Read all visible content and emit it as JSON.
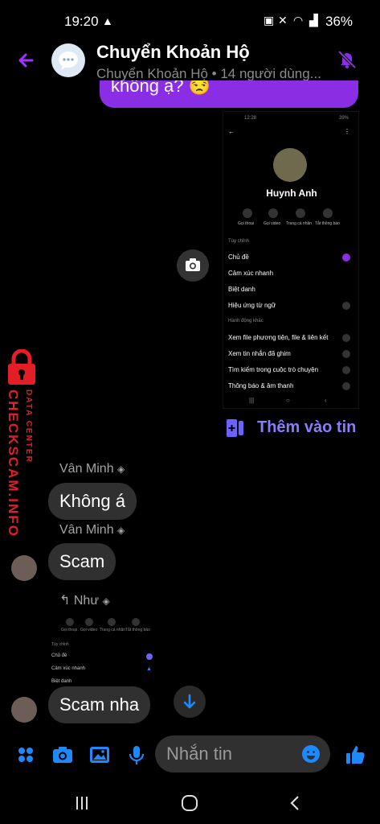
{
  "status_bar": {
    "time": "19:20",
    "battery": "36%"
  },
  "header": {
    "title": "Chuyển Khoản Hộ",
    "subtitle": "Chuyển Khoản Hộ • 14 người dùng..."
  },
  "previous_message": {
    "text": "không ạ? 😒"
  },
  "shared_screenshot": {
    "time": "12:28",
    "battery": "39%",
    "profile_name": "Huynh Anh",
    "actions": [
      "Gọi thoại",
      "Gọi video",
      "Trang cá nhân",
      "Tắt thông báo"
    ],
    "section_customize": "Tùy chỉnh",
    "customize_items": [
      "Chủ đề",
      "Cảm xúc nhanh",
      "Biệt danh",
      "Hiệu ứng từ ngữ"
    ],
    "section_other": "Hành động khác",
    "other_items": [
      "Xem file phương tiện, file & liên kết",
      "Xem tin nhắn đã ghim",
      "Tìm kiếm trong cuộc trò chuyện",
      "Thông báo & âm thanh"
    ]
  },
  "add_story": {
    "label": "Thêm vào tin"
  },
  "watermark": {
    "title": "CHECKSCAM.INFO",
    "subtitle": "DATA CENTER"
  },
  "messages": [
    {
      "sender": "Vân Minh",
      "text": "Không á"
    },
    {
      "sender": "Vân Minh",
      "text": "Scam"
    }
  ],
  "reply": {
    "label": "Như"
  },
  "shared_screenshot_2": {
    "actions": [
      "Gọi thoại",
      "Gọi video",
      "Trang cá nhân",
      "Tắt thông báo"
    ],
    "section_customize": "Tùy chỉnh",
    "items": [
      "Chủ đề",
      "Cảm xúc nhanh",
      "Biệt danh"
    ]
  },
  "last_message": {
    "text": "Scam nha"
  },
  "composer": {
    "placeholder": "Nhắn tin"
  },
  "colors": {
    "accent_purple": "#8a2ee6",
    "accent_blue": "#1e88ff",
    "watermark_red": "#e41e26",
    "bubble_gray": "#303030"
  }
}
